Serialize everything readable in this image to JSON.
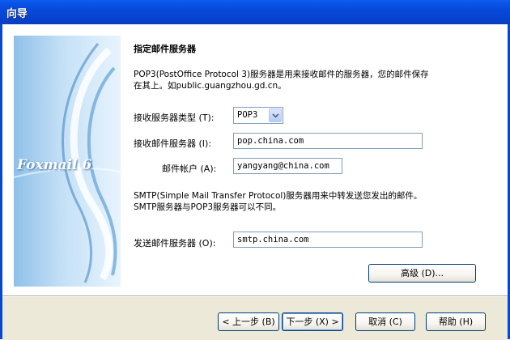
{
  "window": {
    "title": "向导"
  },
  "banner": {
    "logo_text": "Foxmail 6"
  },
  "section": {
    "heading": "指定邮件服务器",
    "pop3_desc_line1": "POP3(PostOffice Protocol 3)服务器是用来接收邮件的服务器，您的邮件保存",
    "pop3_desc_line2": "在其上。如public.guangzhou.gd.cn。",
    "smtp_desc_line1": "SMTP(Simple Mail Transfer Protocol)服务器用来中转发送您发出的邮件。",
    "smtp_desc_line2": "SMTP服务器与POP3服务器可以不同。"
  },
  "fields": {
    "server_type_label": "接收服务器类型 (T):",
    "server_type_value": "POP3",
    "incoming_label": "接收邮件服务器 (I):",
    "incoming_value": "pop.china.com",
    "account_label": "邮件帐户 (A):",
    "account_value": "yangyang@china.com",
    "outgoing_label": "发送邮件服务器 (O):",
    "outgoing_value": "smtp.china.com"
  },
  "buttons": {
    "advanced": "高级 (D)...",
    "back": "< 上一步 (B)",
    "next": "下一步 (X) >",
    "cancel": "取消 (C)",
    "help": "帮助 (H)"
  }
}
